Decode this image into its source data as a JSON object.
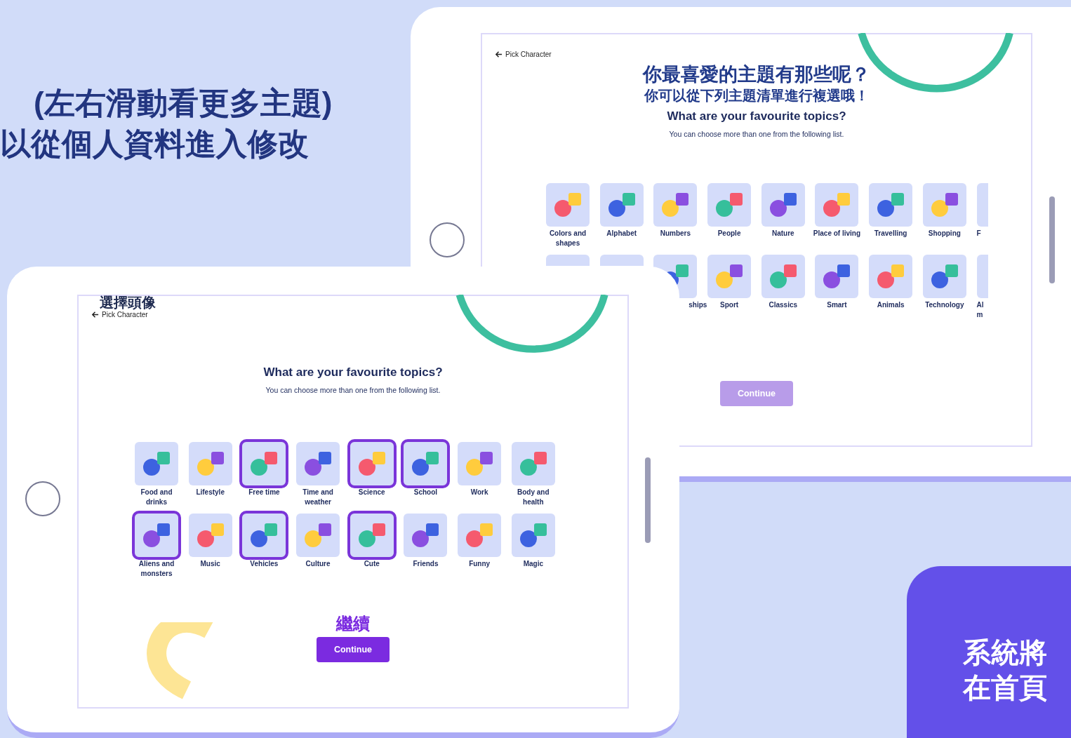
{
  "promo_text": {
    "lines": [
      "(左右滑動看更多主題)",
      "以從個人資料進入修改"
    ]
  },
  "back_screen": {
    "back_link": {
      "label": "Pick Character"
    },
    "annotation_title": "你最喜愛的主題有那些呢？",
    "annotation_subtitle": "你可以從下列主題清單進行複選哦！",
    "heading": "What are your favourite topics?",
    "subheading": "You can choose more than one from the following list.",
    "topics": [
      {
        "kind": "tile",
        "label": "Colors and shapes",
        "selected": false
      },
      {
        "kind": "tile",
        "label": "Alphabet",
        "selected": false
      },
      {
        "kind": "tile",
        "label": "Numbers",
        "selected": false
      },
      {
        "kind": "tile",
        "label": "People",
        "selected": false
      },
      {
        "kind": "tile",
        "label": "Nature",
        "selected": false
      },
      {
        "kind": "tile",
        "label": "Place of living",
        "selected": false
      },
      {
        "kind": "tile",
        "label": "Travelling",
        "selected": false
      },
      {
        "kind": "tile",
        "label": "Shopping",
        "selected": false
      },
      {
        "kind": "cut-right",
        "label": "F",
        "selected": false
      },
      {
        "kind": "hidden",
        "selected": false
      },
      {
        "kind": "hidden",
        "selected": false
      },
      {
        "kind": "cut-left",
        "label": "ships",
        "selected": false
      },
      {
        "kind": "tile",
        "label": "Sport",
        "selected": false
      },
      {
        "kind": "tile",
        "label": "Classics",
        "selected": false
      },
      {
        "kind": "tile",
        "label": "Smart",
        "selected": false
      },
      {
        "kind": "tile",
        "label": "Animals",
        "selected": false
      },
      {
        "kind": "tile",
        "label": "Technology",
        "selected": false
      },
      {
        "kind": "cut-right",
        "label": "Al m",
        "selected": false
      }
    ],
    "continue_button": {
      "label": "Continue",
      "disabled": true
    }
  },
  "front_screen": {
    "annotation": "選擇頭像",
    "back_link": {
      "label": "Pick Character"
    },
    "heading": "What are your favourite topics?",
    "subheading": "You can choose more than one from the following list.",
    "topics": [
      {
        "kind": "tile",
        "label": "Food and drinks",
        "selected": false
      },
      {
        "kind": "tile",
        "label": "Lifestyle",
        "selected": false
      },
      {
        "kind": "tile",
        "label": "Free time",
        "selected": true
      },
      {
        "kind": "tile",
        "label": "Time and weather",
        "selected": false
      },
      {
        "kind": "tile",
        "label": "Science",
        "selected": true
      },
      {
        "kind": "tile",
        "label": "School",
        "selected": true
      },
      {
        "kind": "tile",
        "label": "Work",
        "selected": false
      },
      {
        "kind": "tile",
        "label": "Body and health",
        "selected": false
      },
      {
        "kind": "tile",
        "label": "Aliens and monsters",
        "selected": true
      },
      {
        "kind": "tile",
        "label": "Music",
        "selected": false
      },
      {
        "kind": "tile",
        "label": "Vehicles",
        "selected": true
      },
      {
        "kind": "tile",
        "label": "Culture",
        "selected": false
      },
      {
        "kind": "tile",
        "label": "Cute",
        "selected": true
      },
      {
        "kind": "tile",
        "label": "Friends",
        "selected": false
      },
      {
        "kind": "tile",
        "label": "Funny",
        "selected": false
      },
      {
        "kind": "tile",
        "label": "Magic",
        "selected": false
      }
    ],
    "continue_annotation": "繼續",
    "continue_button": {
      "label": "Continue",
      "disabled": false
    }
  },
  "promo_card": {
    "lines": [
      "系統將",
      "在首頁"
    ]
  }
}
